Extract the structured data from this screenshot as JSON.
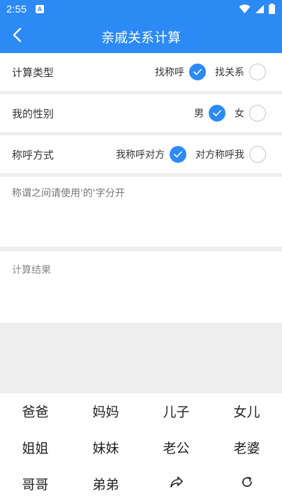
{
  "status": {
    "time": "2:55",
    "app_badge": "A"
  },
  "header": {
    "title": "亲戚关系计算",
    "back_icon": "chevron-left-icon"
  },
  "rows": [
    {
      "label": "计算类型",
      "options": [
        {
          "text": "找称呼",
          "checked": true
        },
        {
          "text": "找关系",
          "checked": false
        }
      ]
    },
    {
      "label": "我的性别",
      "options": [
        {
          "text": "男",
          "checked": true
        },
        {
          "text": "女",
          "checked": false
        }
      ]
    },
    {
      "label": "称呼方式",
      "options": [
        {
          "text": "我称呼对方",
          "checked": true
        },
        {
          "text": "对方称呼我",
          "checked": false
        }
      ]
    }
  ],
  "input": {
    "placeholder": "称谓之间请使用'的'字分开"
  },
  "result": {
    "label": "计算结果"
  },
  "keypad": {
    "keys": [
      "爸爸",
      "妈妈",
      "儿子",
      "女儿",
      "姐姐",
      "妹妹",
      "老公",
      "老婆",
      "哥哥",
      "弟弟"
    ],
    "share_icon": "share-icon",
    "reset_icon": "refresh-icon"
  },
  "colors": {
    "accent": "#2c8af4",
    "background": "#eeeeee"
  }
}
